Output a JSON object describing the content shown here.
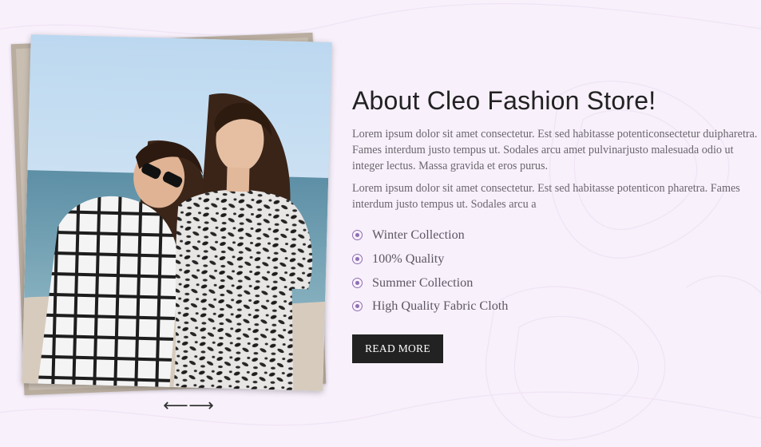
{
  "about": {
    "title": "About Cleo Fashion Store!",
    "paragraphs": [
      "Lorem ipsum dolor sit amet consectetur. Est sed habitasse potenticonsectetur duipharetra. Fames interdum justo tempus ut. Sodales arcu amet pulvinarjusto malesuada odio ut integer lectus. Massa gravida et eros purus.",
      "Lorem ipsum dolor sit amet consectetur. Est sed habitasse potenticon pharetra. Fames interdum justo tempus ut. Sodales arcu a"
    ],
    "features": [
      "Winter Collection",
      "100% Quality",
      "Summer Collection",
      "High Quality Fabric Cloth"
    ],
    "read_more_label": "READ MORE"
  },
  "slider": {
    "prev_glyph": "⟵",
    "next_glyph": "⟶"
  },
  "colors": {
    "background": "#f8f0fb",
    "accent": "#8e6fb0",
    "button": "#222222",
    "text": "#6a6670"
  }
}
